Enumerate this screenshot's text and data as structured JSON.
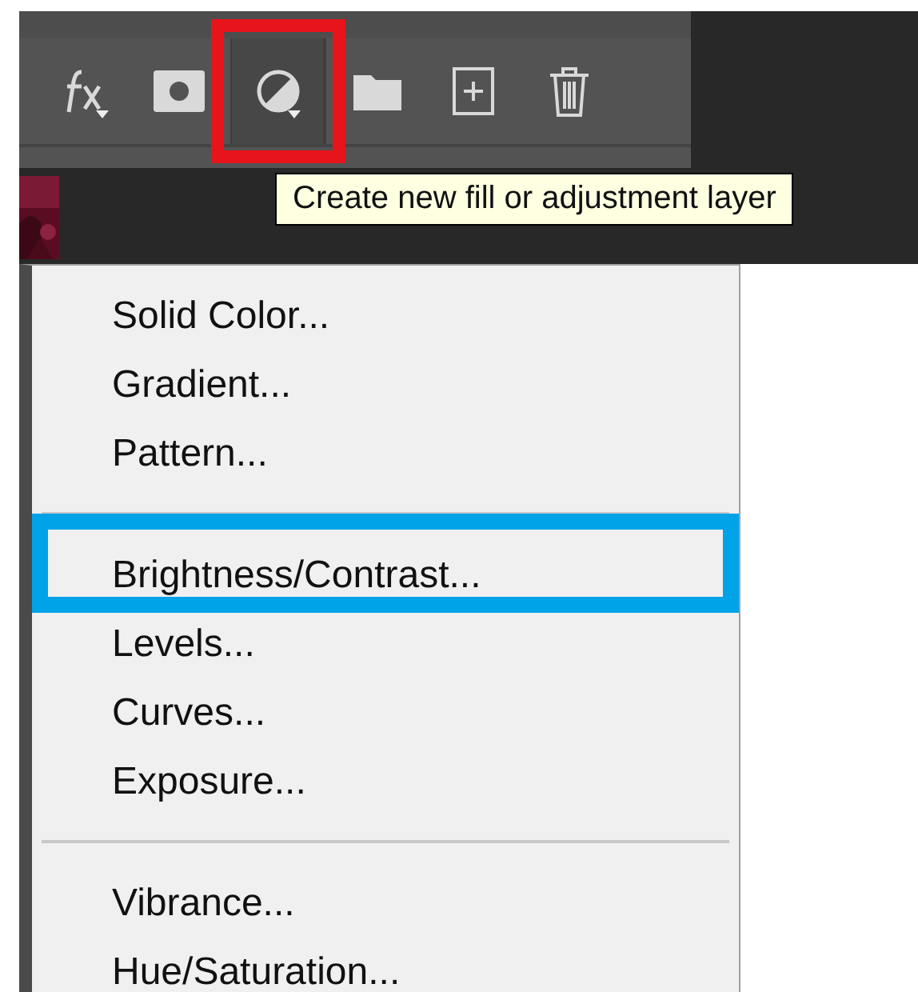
{
  "toolbar": {
    "buttons": [
      {
        "kind": "fx",
        "selected": false,
        "highlighted": false,
        "dropdown": true
      },
      {
        "kind": "mask",
        "selected": false,
        "highlighted": false,
        "dropdown": false
      },
      {
        "kind": "adjustment",
        "selected": true,
        "highlighted": true,
        "dropdown": true
      },
      {
        "kind": "folder",
        "selected": false,
        "highlighted": false,
        "dropdown": false
      },
      {
        "kind": "new",
        "selected": false,
        "highlighted": false,
        "dropdown": false
      },
      {
        "kind": "trash",
        "selected": false,
        "highlighted": false,
        "dropdown": false
      }
    ]
  },
  "tooltip": "Create new fill or adjustment layer",
  "menu": {
    "items": [
      {
        "kind": "item",
        "label": "Solid Color...",
        "highlighted": false
      },
      {
        "kind": "item",
        "label": "Gradient...",
        "highlighted": false
      },
      {
        "kind": "item",
        "label": "Pattern...",
        "highlighted": false
      },
      {
        "kind": "separator"
      },
      {
        "kind": "item",
        "label": "Brightness/Contrast...",
        "highlighted": true
      },
      {
        "kind": "item",
        "label": "Levels...",
        "highlighted": false
      },
      {
        "kind": "item",
        "label": "Curves...",
        "highlighted": false
      },
      {
        "kind": "item",
        "label": "Exposure...",
        "highlighted": false
      },
      {
        "kind": "separator"
      },
      {
        "kind": "item",
        "label": "Vibrance...",
        "highlighted": false
      },
      {
        "kind": "item",
        "label": "Hue/Saturation...",
        "highlighted": false
      }
    ]
  }
}
